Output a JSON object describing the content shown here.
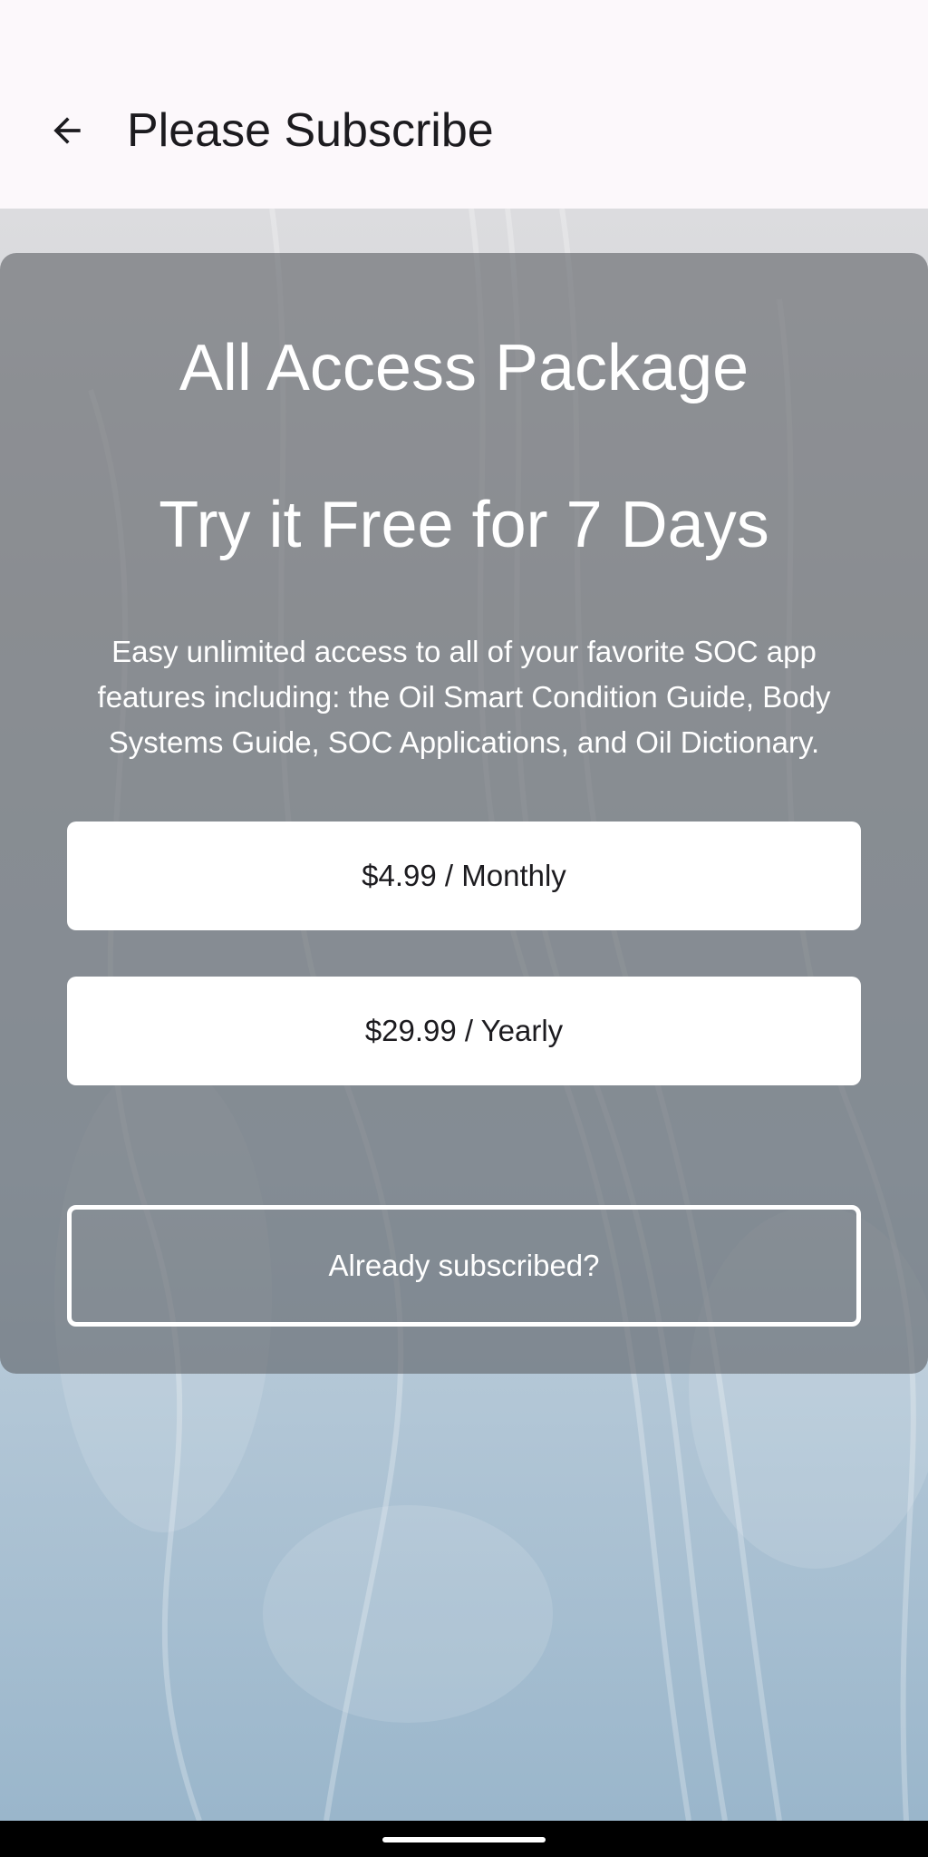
{
  "header": {
    "title": "Please Subscribe",
    "back_icon": "arrow-back-icon"
  },
  "card": {
    "title": "All Access Package",
    "subtitle": "Try it Free for 7 Days",
    "description": "Easy unlimited access to all of your favorite SOC app features including: the Oil Smart Condition Guide, Body Systems Guide, SOC Applications, and Oil Dictionary.",
    "monthly_label": "$4.99 / Monthly",
    "yearly_label": "$29.99 / Yearly",
    "already_label": "Already subscribed?"
  },
  "colors": {
    "app_bar_bg": "#fcf8fb",
    "card_overlay": "#606268",
    "button_bg": "#ffffff",
    "text_dark": "#1c1b1f"
  }
}
